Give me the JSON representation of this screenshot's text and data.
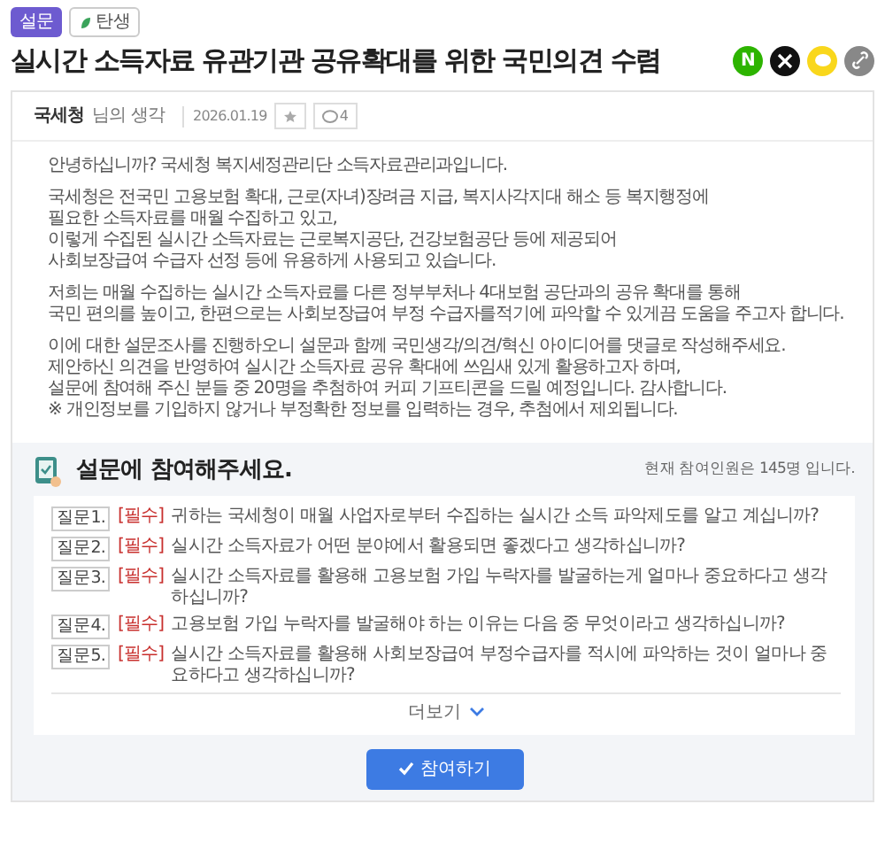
{
  "tags": [
    {
      "kind": "category",
      "label": "설문"
    },
    {
      "kind": "status",
      "label": "탄생"
    }
  ],
  "title": "실시간 소득자료 유관기관 공유확대를 위한 국민의견 수렴",
  "share": [
    {
      "kind": "naver",
      "label": "N"
    },
    {
      "kind": "x"
    },
    {
      "kind": "kakao"
    },
    {
      "kind": "link"
    }
  ],
  "post": {
    "author": "국세청",
    "author_suffix": "님의 생각",
    "date": "2026.01.19",
    "comment_count": "4",
    "paragraphs": [
      [
        "안녕하십니까? 국세청 복지세정관리단 소득자료관리과입니다."
      ],
      [
        "국세청은 전국민 고용보험 확대, 근로(자녀)장려금 지급, 복지사각지대 해소 등 복지행정에",
        "필요한 소득자료를 매월 수집하고 있고,",
        "이렇게 수집된 실시간 소득자료는 근로복지공단, 건강보험공단 등에 제공되어",
        "사회보장급여 수급자 선정 등에 유용하게 사용되고 있습니다."
      ],
      [
        "저희는 매월 수집하는 실시간 소득자료를 다른 정부부처나 4대보험 공단과의 공유 확대를 통해",
        "국민 편의를 높이고, 한편으로는 사회보장급여 부정 수급자를적기에 파악할 수 있게끔 도움을 주고자 합니다."
      ],
      [
        "이에 대한 설문조사를 진행하오니 설문과 함께 국민생각/의견/혁신 아이디어를 댓글로 작성해주세요.",
        "제안하신 의견을 반영하여 실시간 소득자료 공유 확대에 쓰임새 있게 활용하고자 하며,",
        "설문에 참여해 주신 분들 중 20명을 추첨하여 커피 기프티콘을 드릴 예정입니다. 감사합니다.",
        "※ 개인정보를 기입하지 않거나 부정확한 정보를 입력하는 경우, 추첨에서 제외됩니다."
      ]
    ]
  },
  "survey": {
    "heading": "설문에 참여해주세요.",
    "participants": "현재 참여인원은 145명 입니다.",
    "questions": [
      {
        "number": "질문1.",
        "tag": "[필수]",
        "text": "귀하는 국세청이 매월 사업자로부터 수집하는 실시간 소득 파악제도를 알고 계십니까?"
      },
      {
        "number": "질문2.",
        "tag": "[필수]",
        "text": "실시간 소득자료가 어떤 분야에서 활용되면 좋겠다고 생각하십니까?"
      },
      {
        "number": "질문3.",
        "tag": "[필수]",
        "text": "실시간 소득자료를 활용해 고용보험 가입 누락자를 발굴하는게 얼마나 중요하다고 생각하십니까?"
      },
      {
        "number": "질문4.",
        "tag": "[필수]",
        "text": "고용보험 가입 누락자를 발굴해야 하는 이유는 다음 중 무엇이라고 생각하십니까?"
      },
      {
        "number": "질문5.",
        "tag": "[필수]",
        "text": "실시간 소득자료를 활용해 사회보장급여 부정수급자를 적시에 파악하는 것이 얼마나 중요하다고 생각하십니까?"
      }
    ],
    "more": "더보기",
    "submit": "참여하기"
  }
}
